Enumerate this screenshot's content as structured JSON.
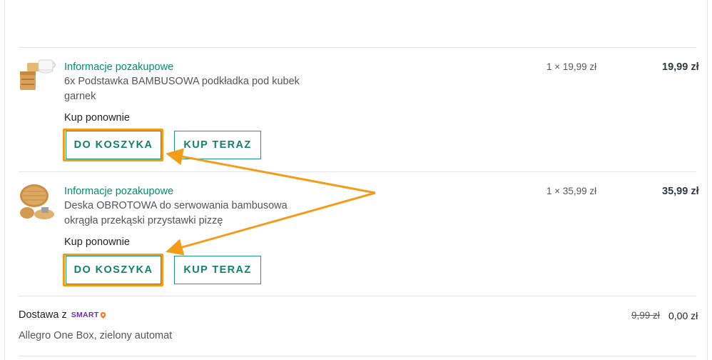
{
  "orders": [
    {
      "title": "Informacje pozakupowe",
      "description": "6x Podstawka BAMBUSOWA podkładka pod kubek garnek",
      "rebuy_label": "Kup ponownie",
      "add_to_cart": "DO KOSZYKA",
      "buy_now": "KUP TERAZ",
      "quantity": "1 × 19,99 zł",
      "price": "19,99 zł",
      "thumbnail_icon": "bamboo-coaster-mug-image"
    },
    {
      "title": "Informacje pozakupowe",
      "description": "Deska OBROTOWA do serwowania bambusowa okrągła przekąski przystawki pizzę",
      "rebuy_label": "Kup ponownie",
      "add_to_cart": "DO KOSZYKA",
      "buy_now": "KUP TERAZ",
      "quantity": "1 × 35,99 zł",
      "price": "35,99 zł",
      "thumbnail_icon": "bamboo-serving-board-image"
    }
  ],
  "delivery": {
    "label": "Dostawa z",
    "brand": "SMART",
    "description": "Allegro One Box, zielony automat",
    "old_price": "9,99 zł",
    "price": "0,00 zł"
  },
  "colors": {
    "accent": "#008f6b",
    "button_border": "#1d9c83",
    "annotation": "#f39c1a",
    "smart_brand": "#6a2fb0"
  }
}
